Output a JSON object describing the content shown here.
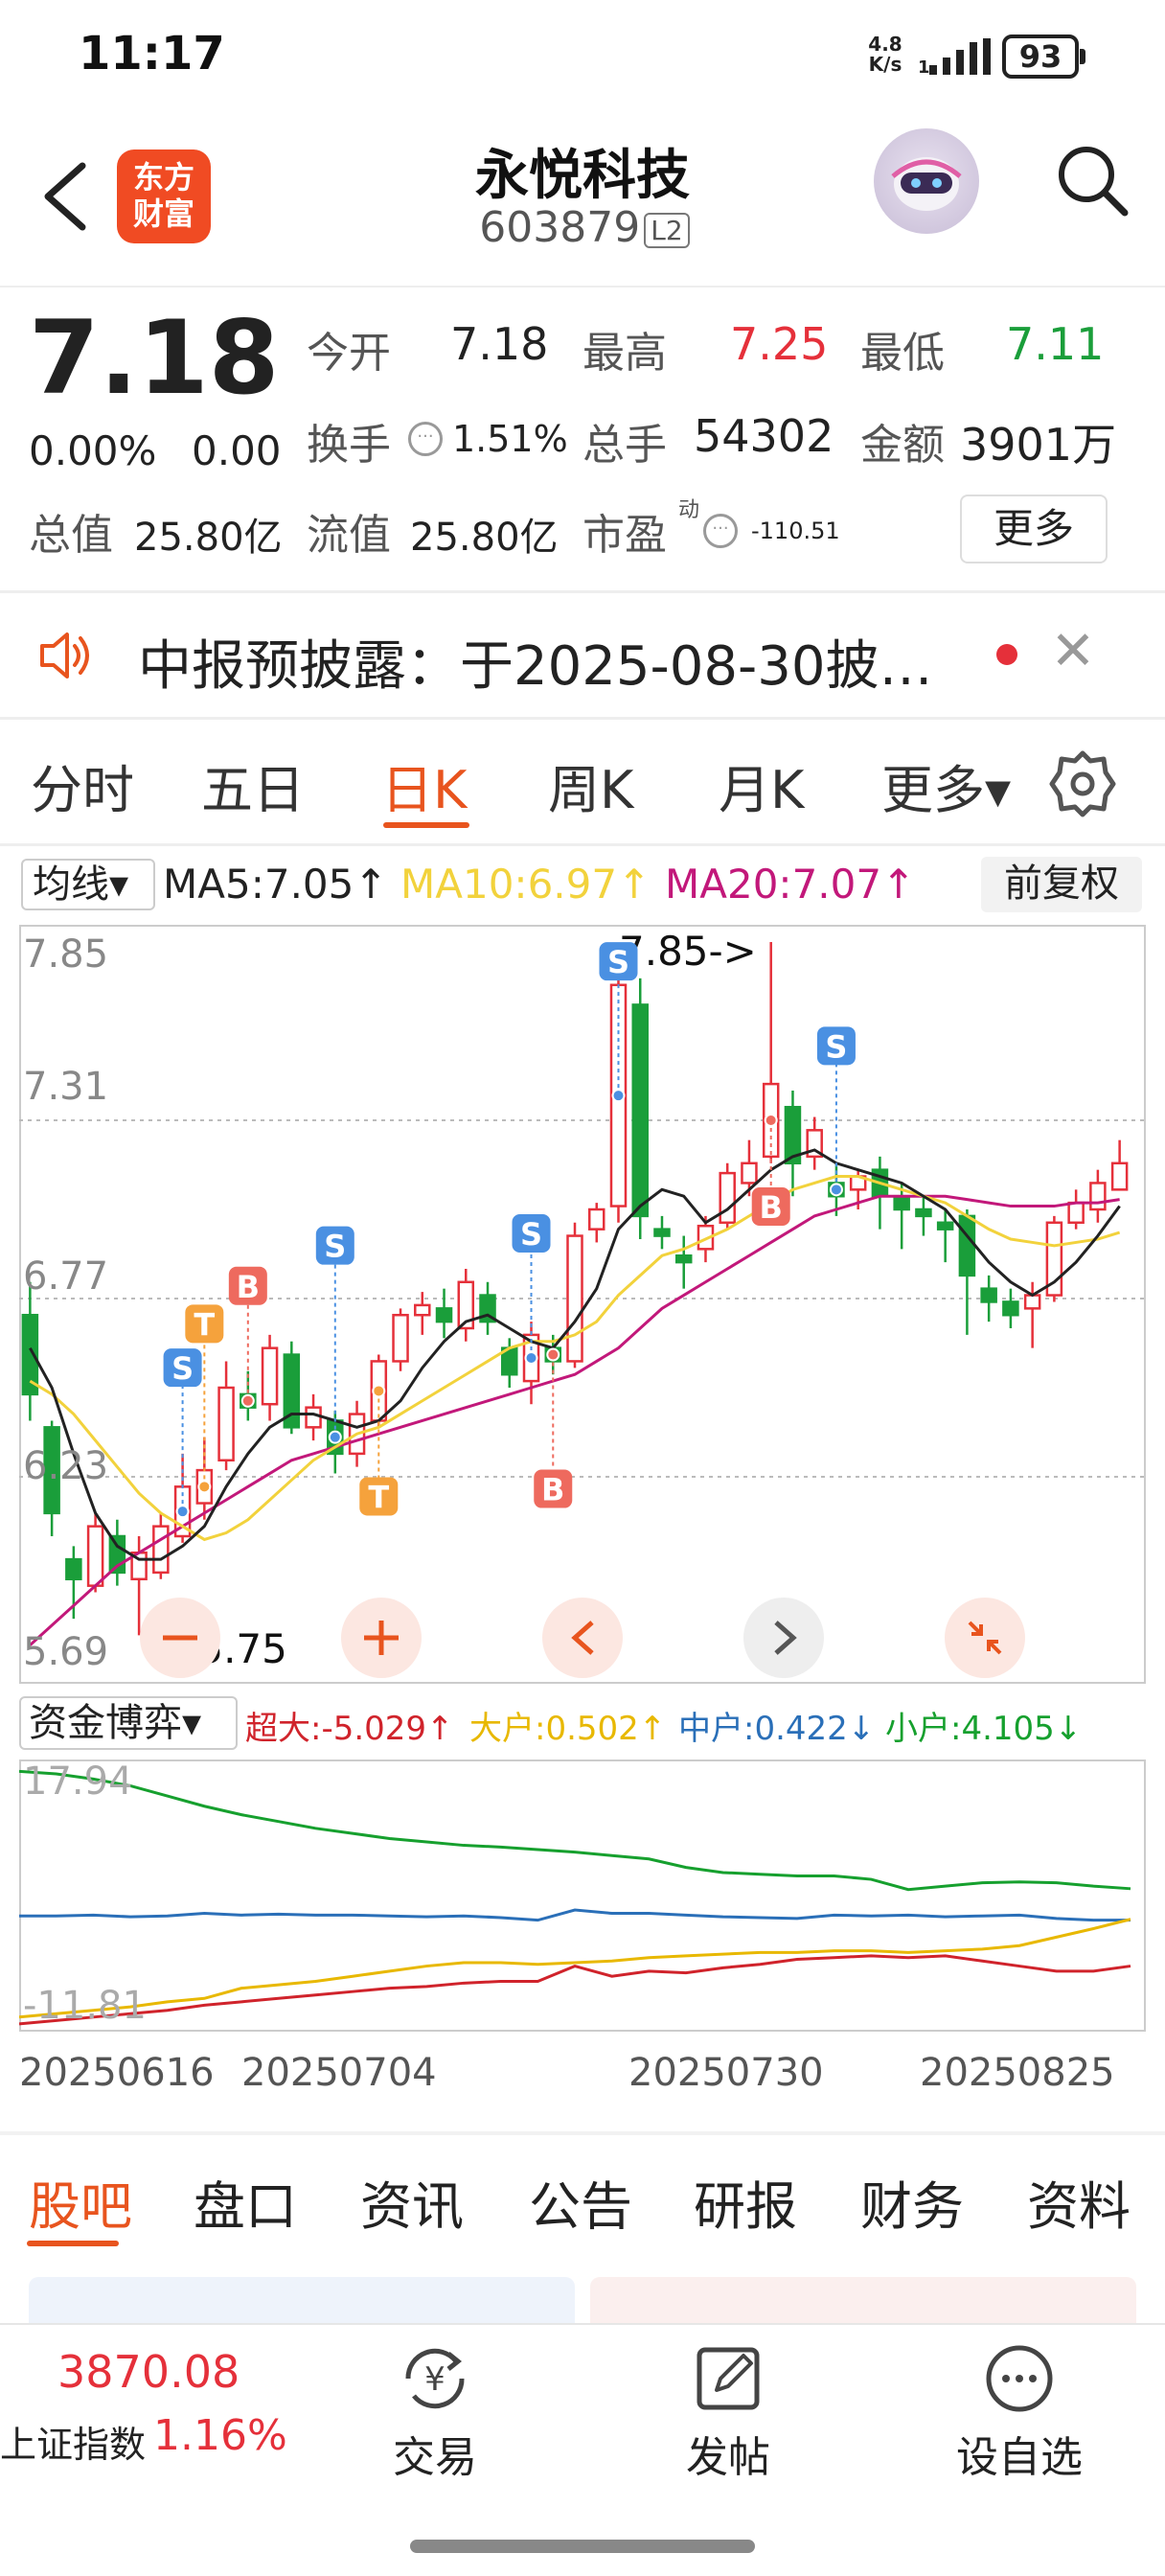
{
  "status_bar": {
    "time": "11:17",
    "net_speed": "4.8",
    "net_unit": "K/s",
    "battery": "93"
  },
  "header": {
    "logo_line1": "东方",
    "logo_line2": "财富",
    "stock_name": "永悦科技",
    "stock_code": "603879",
    "level_badge": "L2",
    "icons": [
      "back-arrow-icon",
      "robot-avatar-icon",
      "search-icon"
    ]
  },
  "quote": {
    "price": "7.18",
    "change_pct": "0.00%",
    "change_abs": "0.00",
    "open_label": "今开",
    "open": "7.18",
    "high_label": "最高",
    "high": "7.25",
    "low_label": "最低",
    "low": "7.11",
    "turnover_label": "换手",
    "turnover": "1.51%",
    "volume_label": "总手",
    "volume": "54302",
    "amount_label": "金额",
    "amount": "3901万",
    "mcap_label": "总值",
    "mcap": "25.80亿",
    "float_label": "流值",
    "float_mcap": "25.80亿",
    "pe_label": "市盈",
    "pe_sup": "动",
    "pe": "-110.51",
    "more_button": "更多",
    "colors": {
      "up": "#e5303a",
      "down": "#1a9e3a"
    }
  },
  "notice": {
    "text": "中报预披露：于2025-08-30披…",
    "icon": "speaker-icon"
  },
  "period_tabs": {
    "items": [
      "分时",
      "五日",
      "日K",
      "周K",
      "月K",
      "更多▾"
    ],
    "active": "日K"
  },
  "ma_bar": {
    "selector": "均线▾",
    "ma5": "MA5:7.05↑",
    "ma10": "MA10:6.97↑",
    "ma20": "MA20:7.07↑",
    "adjust_button": "前复权",
    "colors": {
      "ma5": "#222222",
      "ma10": "#f2d23c",
      "ma20": "#c2187a"
    }
  },
  "kline_chart": {
    "y_labels": [
      "7.85",
      "7.31",
      "6.77",
      "6.23",
      "5.69"
    ],
    "max_label": "7.85->",
    "min_label": "<-5.75",
    "signals": [
      "S",
      "T",
      "B"
    ],
    "controls": [
      "minus-icon",
      "plus-icon",
      "chevron-left-icon",
      "chevron-right-icon",
      "collapse-icon"
    ]
  },
  "chart_data": {
    "type": "candlestick",
    "ylim": [
      5.69,
      7.85
    ],
    "y_ticks": [
      7.85,
      7.31,
      6.77,
      6.23,
      5.69
    ],
    "x_ticks": [
      "20250616",
      "20250704",
      "20250730",
      "20250825"
    ],
    "candles": [
      {
        "o": 6.72,
        "c": 6.48,
        "h": 6.82,
        "l": 6.4
      },
      {
        "o": 6.38,
        "c": 6.12,
        "h": 6.4,
        "l": 6.05
      },
      {
        "o": 5.98,
        "c": 5.92,
        "h": 6.02,
        "l": 5.8
      },
      {
        "o": 5.9,
        "c": 6.08,
        "h": 6.12,
        "l": 5.88
      },
      {
        "o": 6.05,
        "c": 5.94,
        "h": 6.1,
        "l": 5.9
      },
      {
        "o": 5.92,
        "c": 6.0,
        "h": 6.05,
        "l": 5.75
      },
      {
        "o": 5.94,
        "c": 6.08,
        "h": 6.12,
        "l": 5.92
      },
      {
        "o": 6.05,
        "c": 6.2,
        "h": 6.3,
        "l": 6.03
      },
      {
        "o": 6.15,
        "c": 6.25,
        "h": 6.35,
        "l": 6.1
      },
      {
        "o": 6.28,
        "c": 6.5,
        "h": 6.58,
        "l": 6.25
      },
      {
        "o": 6.48,
        "c": 6.44,
        "h": 6.55,
        "l": 6.4
      },
      {
        "o": 6.45,
        "c": 6.62,
        "h": 6.66,
        "l": 6.4
      },
      {
        "o": 6.6,
        "c": 6.38,
        "h": 6.64,
        "l": 6.36
      },
      {
        "o": 6.38,
        "c": 6.44,
        "h": 6.48,
        "l": 6.34
      },
      {
        "o": 6.4,
        "c": 6.3,
        "h": 6.43,
        "l": 6.24
      },
      {
        "o": 6.3,
        "c": 6.42,
        "h": 6.46,
        "l": 6.26
      },
      {
        "o": 6.4,
        "c": 6.58,
        "h": 6.6,
        "l": 6.38
      },
      {
        "o": 6.58,
        "c": 6.72,
        "h": 6.74,
        "l": 6.55
      },
      {
        "o": 6.72,
        "c": 6.75,
        "h": 6.79,
        "l": 6.66
      },
      {
        "o": 6.74,
        "c": 6.7,
        "h": 6.8,
        "l": 6.65
      },
      {
        "o": 6.68,
        "c": 6.82,
        "h": 6.86,
        "l": 6.64
      },
      {
        "o": 6.78,
        "c": 6.7,
        "h": 6.82,
        "l": 6.66
      },
      {
        "o": 6.62,
        "c": 6.54,
        "h": 6.65,
        "l": 6.5
      },
      {
        "o": 6.52,
        "c": 6.66,
        "h": 6.7,
        "l": 6.45
      },
      {
        "o": 6.62,
        "c": 6.58,
        "h": 6.66,
        "l": 6.54
      },
      {
        "o": 6.58,
        "c": 6.96,
        "h": 7.0,
        "l": 6.56
      },
      {
        "o": 6.98,
        "c": 7.04,
        "h": 7.06,
        "l": 6.94
      },
      {
        "o": 7.05,
        "c": 7.72,
        "h": 7.78,
        "l": 7.0
      },
      {
        "o": 7.66,
        "c": 7.02,
        "h": 7.74,
        "l": 6.95
      },
      {
        "o": 6.98,
        "c": 6.96,
        "h": 7.02,
        "l": 6.92
      },
      {
        "o": 6.9,
        "c": 6.88,
        "h": 6.96,
        "l": 6.8
      },
      {
        "o": 6.92,
        "c": 6.99,
        "h": 7.02,
        "l": 6.88
      },
      {
        "o": 7.0,
        "c": 7.15,
        "h": 7.18,
        "l": 6.98
      },
      {
        "o": 7.12,
        "c": 7.18,
        "h": 7.25,
        "l": 7.08
      },
      {
        "o": 7.2,
        "c": 7.42,
        "h": 7.85,
        "l": 7.18
      },
      {
        "o": 7.35,
        "c": 7.18,
        "h": 7.4,
        "l": 7.08
      },
      {
        "o": 7.2,
        "c": 7.28,
        "h": 7.32,
        "l": 7.16
      },
      {
        "o": 7.12,
        "c": 7.08,
        "h": 7.18,
        "l": 7.02
      },
      {
        "o": 7.1,
        "c": 7.14,
        "h": 7.16,
        "l": 7.04
      },
      {
        "o": 7.16,
        "c": 7.08,
        "h": 7.2,
        "l": 6.98
      },
      {
        "o": 7.08,
        "c": 7.04,
        "h": 7.12,
        "l": 6.92
      },
      {
        "o": 7.04,
        "c": 7.02,
        "h": 7.08,
        "l": 6.96
      },
      {
        "o": 7.0,
        "c": 6.98,
        "h": 7.04,
        "l": 6.88
      },
      {
        "o": 7.02,
        "c": 6.84,
        "h": 7.04,
        "l": 6.66
      },
      {
        "o": 6.8,
        "c": 6.76,
        "h": 6.84,
        "l": 6.7
      },
      {
        "o": 6.76,
        "c": 6.72,
        "h": 6.8,
        "l": 6.68
      },
      {
        "o": 6.74,
        "c": 6.78,
        "h": 6.82,
        "l": 6.62
      },
      {
        "o": 6.78,
        "c": 7.0,
        "h": 7.02,
        "l": 6.76
      },
      {
        "o": 7.0,
        "c": 7.06,
        "h": 7.1,
        "l": 6.98
      },
      {
        "o": 7.04,
        "c": 7.12,
        "h": 7.16,
        "l": 7.0
      },
      {
        "o": 7.1,
        "c": 7.18,
        "h": 7.25,
        "l": 7.11
      }
    ],
    "ma5": [
      6.62,
      6.5,
      6.3,
      6.12,
      6.02,
      5.98,
      5.98,
      6.02,
      6.08,
      6.2,
      6.3,
      6.38,
      6.42,
      6.42,
      6.4,
      6.38,
      6.4,
      6.46,
      6.56,
      6.64,
      6.7,
      6.72,
      6.68,
      6.64,
      6.62,
      6.7,
      6.8,
      6.98,
      7.05,
      7.1,
      7.08,
      7.0,
      7.04,
      7.1,
      7.16,
      7.2,
      7.22,
      7.18,
      7.16,
      7.14,
      7.12,
      7.08,
      7.04,
      6.96,
      6.88,
      6.82,
      6.78,
      6.82,
      6.88,
      6.96,
      7.05
    ],
    "ma10": [
      6.52,
      6.48,
      6.42,
      6.34,
      6.26,
      6.18,
      6.12,
      6.08,
      6.04,
      6.06,
      6.1,
      6.16,
      6.22,
      6.28,
      6.32,
      6.36,
      6.38,
      6.42,
      6.46,
      6.5,
      6.54,
      6.58,
      6.62,
      6.64,
      6.64,
      6.66,
      6.7,
      6.78,
      6.84,
      6.9,
      6.92,
      6.95,
      6.98,
      7.02,
      7.06,
      7.1,
      7.12,
      7.14,
      7.14,
      7.12,
      7.1,
      7.08,
      7.06,
      7.02,
      6.98,
      6.95,
      6.94,
      6.93,
      6.94,
      6.95,
      6.97
    ],
    "ma20": [
      5.72,
      5.78,
      5.84,
      5.9,
      5.96,
      6.0,
      6.04,
      6.08,
      6.12,
      6.16,
      6.2,
      6.24,
      6.28,
      6.3,
      6.32,
      6.34,
      6.36,
      6.38,
      6.4,
      6.42,
      6.44,
      6.46,
      6.48,
      6.5,
      6.52,
      6.54,
      6.58,
      6.62,
      6.68,
      6.74,
      6.78,
      6.82,
      6.86,
      6.9,
      6.94,
      6.98,
      7.02,
      7.04,
      7.06,
      7.08,
      7.08,
      7.08,
      7.08,
      7.07,
      7.06,
      7.05,
      7.05,
      7.05,
      7.06,
      7.06,
      7.07
    ]
  },
  "fund_bar": {
    "selector": "资金博弈▾",
    "super": "超大:-5.029↑",
    "large": "大户:0.502↑",
    "medium": "中户:0.422↓",
    "small": "小户:4.105↓",
    "colors": {
      "super": "#d0232b",
      "large": "#e8b800",
      "medium": "#2a6fb8",
      "small": "#16a02e"
    }
  },
  "fund_chart": {
    "y_top": "17.94",
    "y_bottom": "-11.81",
    "ylim": [
      -11.81,
      17.94
    ],
    "series": [
      {
        "name": "小户",
        "values": [
          17.9,
          17.6,
          17.0,
          16.2,
          15.0,
          13.8,
          12.8,
          12.0,
          11.2,
          10.6,
          10.0,
          9.6,
          9.2,
          9.0,
          8.7,
          8.4,
          8.0,
          7.6,
          6.6,
          6.0,
          5.8,
          5.6,
          5.6,
          5.2,
          4.0,
          4.4,
          4.8,
          4.9,
          4.8,
          4.4,
          4.1
        ]
      },
      {
        "name": "中户",
        "values": [
          0.9,
          0.9,
          1.0,
          0.8,
          0.9,
          1.2,
          1.0,
          1.1,
          1.0,
          1.0,
          0.9,
          0.8,
          0.9,
          0.7,
          0.4,
          1.6,
          1.2,
          1.2,
          1.0,
          0.8,
          0.7,
          0.6,
          1.0,
          0.9,
          1.0,
          0.8,
          0.9,
          1.0,
          0.6,
          0.4,
          0.4
        ]
      },
      {
        "name": "大户",
        "values": [
          -11.0,
          -10.6,
          -10.2,
          -9.8,
          -9.2,
          -8.8,
          -7.6,
          -7.2,
          -6.8,
          -6.2,
          -5.6,
          -5.0,
          -4.6,
          -4.6,
          -4.8,
          -4.6,
          -4.4,
          -4.0,
          -3.8,
          -3.6,
          -3.4,
          -3.4,
          -3.2,
          -3.2,
          -3.4,
          -3.2,
          -3.0,
          -2.6,
          -1.6,
          -0.6,
          0.5
        ]
      },
      {
        "name": "超大",
        "values": [
          -11.8,
          -11.4,
          -11.0,
          -10.6,
          -10.2,
          -9.6,
          -9.2,
          -8.8,
          -8.4,
          -8.0,
          -7.6,
          -7.4,
          -7.0,
          -6.8,
          -6.8,
          -5.0,
          -6.2,
          -5.6,
          -5.8,
          -5.2,
          -4.8,
          -4.2,
          -4.0,
          -3.8,
          -4.0,
          -3.8,
          -4.4,
          -5.0,
          -5.6,
          -5.6,
          -5.0
        ]
      }
    ]
  },
  "dates": [
    "20250616",
    "20250704",
    "20250730",
    "20250825"
  ],
  "bottom_tabs": {
    "items": [
      "股吧",
      "盘口",
      "资讯",
      "公告",
      "研报",
      "财务",
      "资料"
    ],
    "active": "股吧"
  },
  "bottom_bar": {
    "index_value": "3870.08",
    "index_name": "上证指数",
    "index_pct": "1.16%",
    "trade_label": "交易",
    "post_label": "发帖",
    "watch_label": "设自选"
  }
}
